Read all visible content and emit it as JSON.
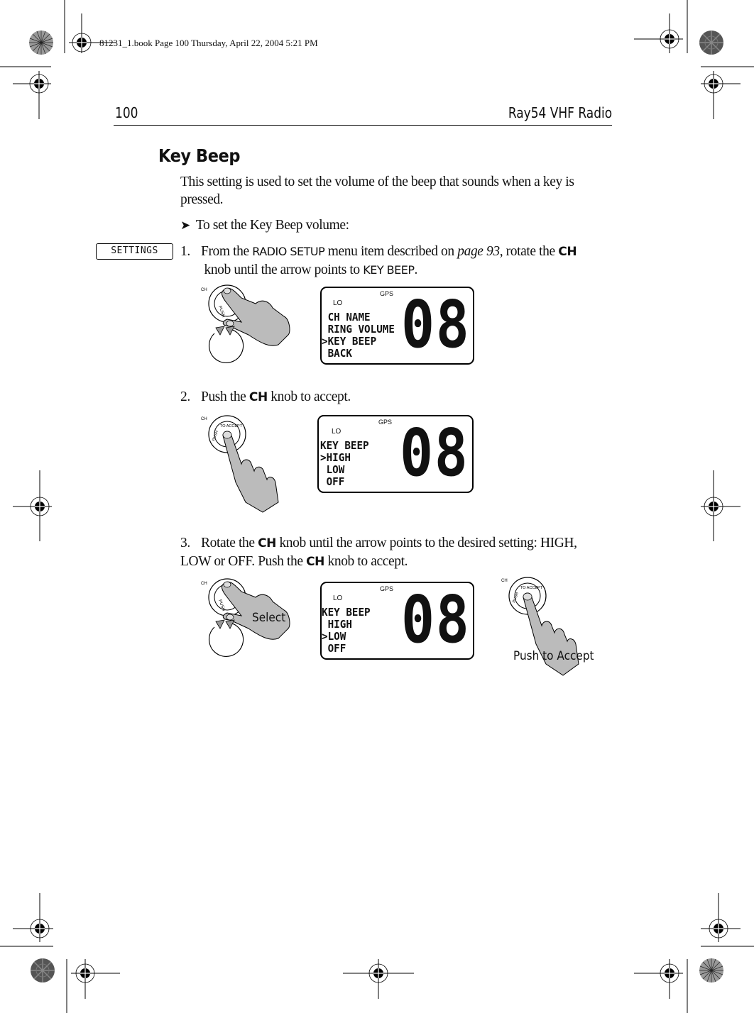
{
  "print_slug": "81231_1.book  Page 100  Thursday, April 22, 2004  5:21 PM",
  "header": {
    "page_number": "100",
    "running_title": "Ray54 VHF Radio"
  },
  "section": {
    "title": "Key Beep",
    "intro": "This setting is used to set the volume of the beep that sounds when a key is pressed.",
    "procedure_bullet": "➤",
    "procedure_heading": "To set the Key Beep volume:"
  },
  "side_button": {
    "label": "SETTINGS"
  },
  "steps": [
    {
      "number": "1.",
      "parts": [
        "From the ",
        "RADIO SETUP",
        " menu item described on ",
        "page 93",
        ", rotate the ",
        "CH",
        " knob until the arrow points to ",
        "KEY BEEP",
        "."
      ]
    },
    {
      "number": "2.",
      "parts": [
        "Push the ",
        "CH",
        " knob to accept."
      ]
    },
    {
      "number": "3.",
      "parts": [
        "Rotate the ",
        "CH",
        " knob until the arrow points to the desired setting: HIGH, LOW or OFF. Push the ",
        "CH",
        " knob to accept."
      ]
    }
  ],
  "figures": {
    "fig1": {
      "knob_label": "CH",
      "knob_ring_text": "PUSH TO ACCEPT",
      "lcd": {
        "gps": "GPS",
        "lo": "LO",
        "lines": " CH NAME\n RING VOLUME\n>KEY BEEP\n BACK",
        "channel": "08"
      }
    },
    "fig2": {
      "knob_label": "CH",
      "knob_ring_text": "PUSH TO ACCEPT",
      "lcd": {
        "gps": "GPS",
        "lo": "LO",
        "lines": "KEY BEEP\n>HIGH\n LOW\n OFF",
        "channel": "08"
      }
    },
    "fig3": {
      "knob_label": "CH",
      "select_caption": "Select",
      "accept_caption": "Push to Accept",
      "lcd": {
        "gps": "GPS",
        "lo": "LO",
        "lines": "KEY BEEP\n HIGH\n>LOW\n OFF",
        "channel": "08"
      }
    }
  }
}
